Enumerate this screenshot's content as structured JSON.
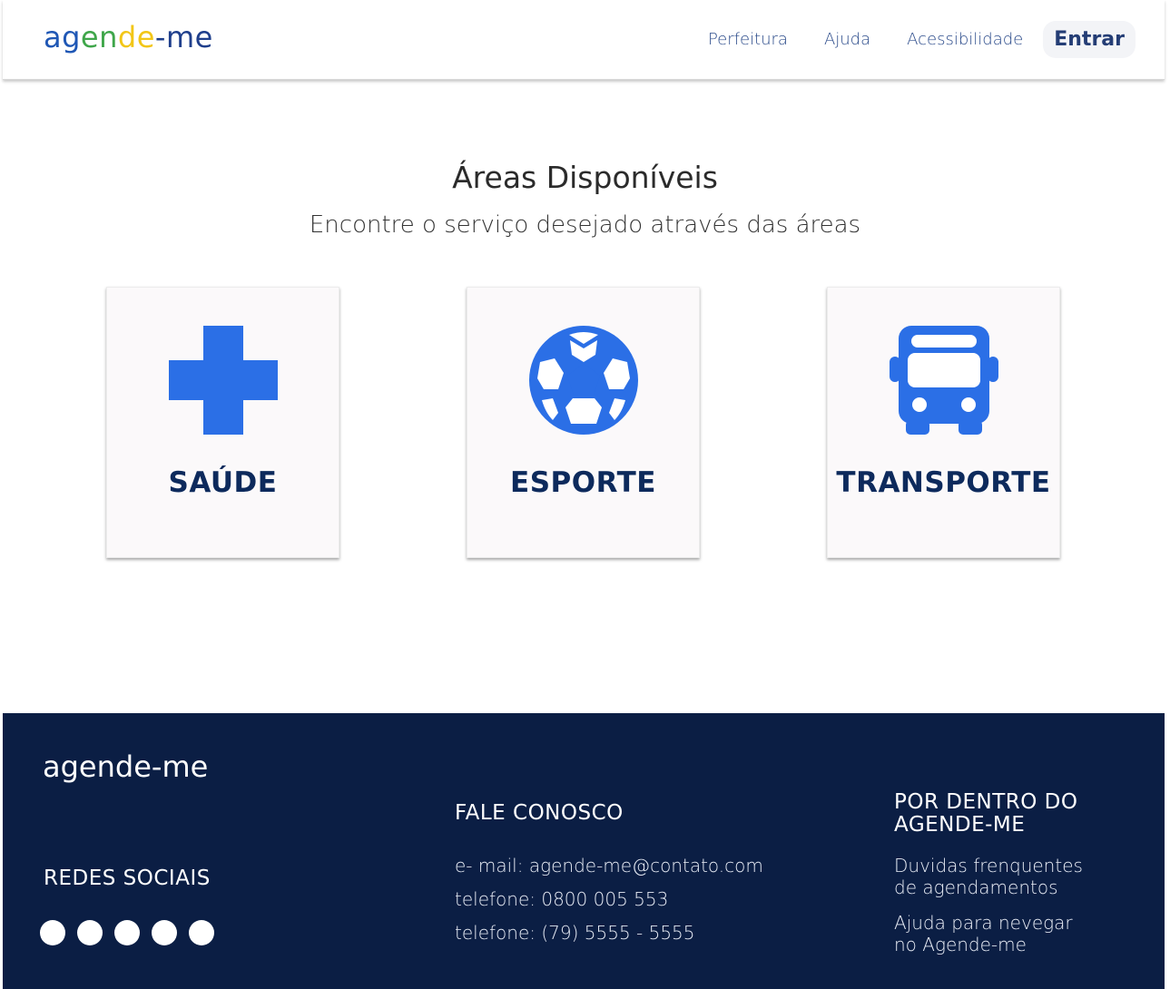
{
  "header": {
    "logo_parts": [
      {
        "text": "ag",
        "color": "#1f57b5"
      },
      {
        "text": "en",
        "color": "#3fa64a"
      },
      {
        "text": "de",
        "color": "#f2c617"
      },
      {
        "text": "-me",
        "color": "#1f3f8c"
      }
    ],
    "nav": [
      "Perfeitura",
      "Ajuda",
      "Acessibilidade"
    ],
    "login_label": "Entrar"
  },
  "main": {
    "title": "Áreas Disponíveis",
    "subtitle": "Encontre o serviço desejado através das áreas",
    "cards": [
      {
        "label": "SAÚDE",
        "icon": "health-cross-icon"
      },
      {
        "label": "ESPORTE",
        "icon": "soccer-ball-icon"
      },
      {
        "label": "TRANSPORTE",
        "icon": "bus-icon"
      }
    ],
    "icon_color": "#2b6fe6"
  },
  "footer": {
    "logo": "agende-me",
    "social_title": "REDES SOCIAIS",
    "contact_title": "FALE CONOSCO",
    "contact_lines": [
      "e- mail: agende-me@contato.com",
      "telefone: 0800 005 553",
      "telefone: (79) 5555 - 5555"
    ],
    "about_title_1": "POR DENTRO DO",
    "about_title_2": "AGENDE-ME",
    "links": [
      {
        "l1": "Duvidas frenquentes",
        "l2": "de agendamentos"
      },
      {
        "l1": "Ajuda para nevegar",
        "l2": "no Agende-me"
      }
    ],
    "background": "#0b1e44"
  }
}
